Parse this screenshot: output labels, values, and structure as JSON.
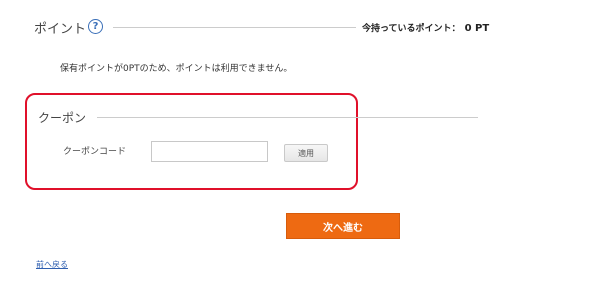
{
  "points": {
    "title": "ポイント",
    "help_icon_glyph": "?",
    "current_label": "今持っているポイント：",
    "current_value": "0 PT",
    "note": "保有ポイントが0PTのため、ポイントは利用できません。"
  },
  "coupon": {
    "title": "クーポン",
    "code_label": "クーポンコード",
    "code_value": "",
    "code_placeholder": "",
    "apply_label": "適用"
  },
  "navigation": {
    "next_label": "次へ進む",
    "back_label": "前へ戻る"
  },
  "colors": {
    "accent_orange": "#ee6a12",
    "highlight_red": "#e0102a",
    "link_blue": "#2f5fb0",
    "help_icon_blue": "#3a6fb8"
  },
  "icons": {
    "help": "question-circle-icon"
  }
}
